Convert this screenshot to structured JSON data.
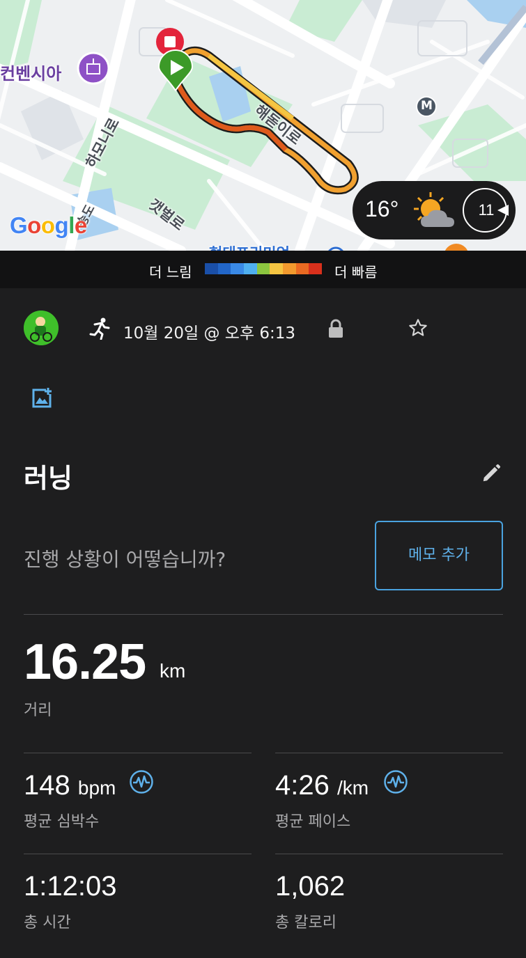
{
  "map": {
    "poi_label": "컨벤시아",
    "roads": [
      "해돋이로",
      "하모니로",
      "갯벌로",
      "송도"
    ],
    "bottom_label": "현대프리미엄",
    "metro_label": "M",
    "logo": "Google",
    "route_colors": [
      "#f5a623",
      "#e8871a",
      "#d9481c",
      "#c0301c"
    ]
  },
  "weather": {
    "temp": "16°",
    "icon": "partly-sunny-icon",
    "wind": "11"
  },
  "legend": {
    "slow": "더 느림",
    "fast": "더 빠름",
    "colors": [
      "#1a4fa8",
      "#2266c8",
      "#3a8ae6",
      "#4fb0f0",
      "#8cc63f",
      "#f5c542",
      "#f29a2e",
      "#ea6a22",
      "#d9301c"
    ]
  },
  "activity": {
    "type_icon": "running-icon",
    "date": "10월 20일 @ 오후 6:13",
    "title": "러닝",
    "prompt": "진행 상황이 어떻습니까?",
    "memo_button": "메모 추가"
  },
  "stats": {
    "distance": {
      "value": "16.25",
      "unit": "km",
      "label": "거리"
    },
    "heart_rate": {
      "value": "148",
      "unit": "bpm",
      "label": "평균 심박수"
    },
    "pace": {
      "value": "4:26",
      "unit": "/km",
      "label": "평균 페이스"
    },
    "time": {
      "value": "1:12:03",
      "label": "총 시간"
    },
    "calories": {
      "value": "1,062",
      "label": "총 칼로리"
    }
  },
  "colors": {
    "accent": "#5fb1ea",
    "background": "#1e1e1f",
    "muted_text": "#a9a9ab"
  }
}
